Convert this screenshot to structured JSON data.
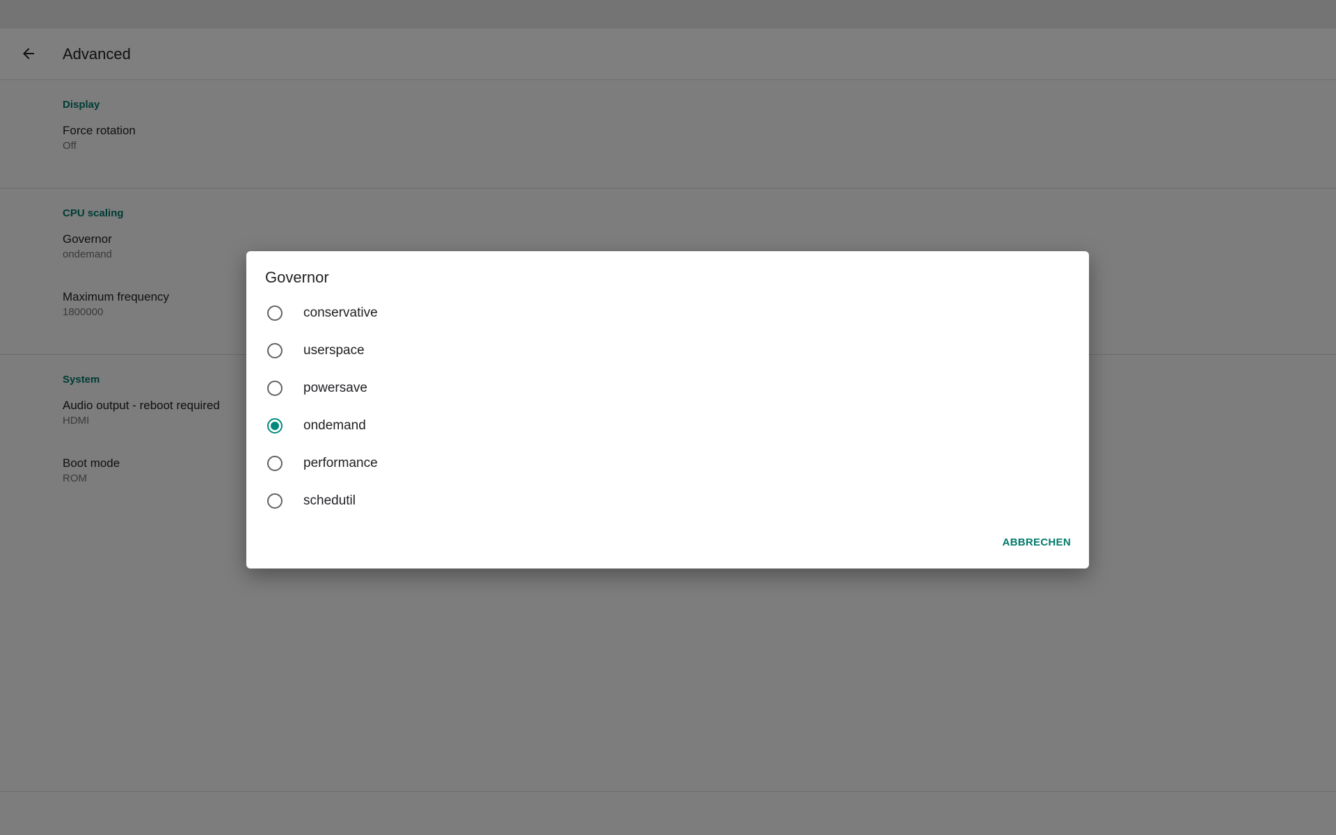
{
  "app_bar": {
    "title": "Advanced",
    "back_icon": "arrow-back-icon"
  },
  "sections": [
    {
      "header": "Display",
      "items": [
        {
          "title": "Force rotation",
          "summary": "Off"
        }
      ]
    },
    {
      "header": "CPU scaling",
      "items": [
        {
          "title": "Governor",
          "summary": "ondemand"
        },
        {
          "title": "Maximum frequency",
          "summary": "1800000"
        }
      ]
    },
    {
      "header": "System",
      "items": [
        {
          "title": "Audio output - reboot required",
          "summary": "HDMI"
        },
        {
          "title": "Boot mode",
          "summary": "ROM"
        }
      ]
    }
  ],
  "dialog": {
    "title": "Governor",
    "options": [
      {
        "label": "conservative",
        "checked": false
      },
      {
        "label": "userspace",
        "checked": false
      },
      {
        "label": "powersave",
        "checked": false
      },
      {
        "label": "ondemand",
        "checked": true
      },
      {
        "label": "performance",
        "checked": false
      },
      {
        "label": "schedutil",
        "checked": false
      }
    ],
    "cancel_label": "ABBRECHEN"
  },
  "colors": {
    "accent": "#00897b",
    "section_header": "#00796b",
    "scrim": "rgba(0,0,0,0.5)"
  }
}
